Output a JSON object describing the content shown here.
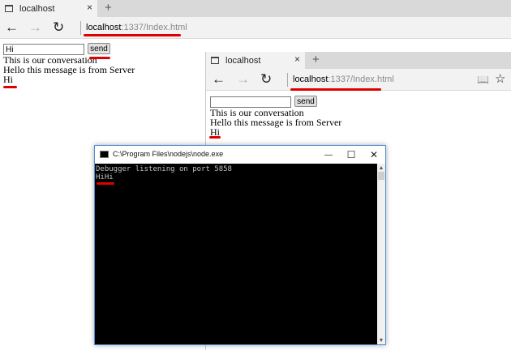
{
  "browser1": {
    "tab_title": "localhost",
    "tab_close": "×",
    "new_tab": "+",
    "back": "←",
    "forward": "→",
    "refresh": "↻",
    "address_host": "localhost",
    "address_path": ":1337/Index.html",
    "input_value": "Hi",
    "send_label": "send",
    "lines": [
      "This is our conversation",
      "Hello this message is from Server",
      "Hi"
    ]
  },
  "browser2": {
    "tab_title": "localhost",
    "tab_close": "×",
    "new_tab": "+",
    "back": "←",
    "forward": "→",
    "refresh": "↻",
    "address_host": "localhost",
    "address_path": ":1337/Index.html",
    "reading_view": "📖",
    "favorite": "☆",
    "input_value": "",
    "send_label": "send",
    "lines": [
      "This is our conversation",
      "Hello this message is from Server",
      "Hi"
    ]
  },
  "console": {
    "title": "C:\\Program Files\\nodejs\\node.exe",
    "minimize": "—",
    "maximize": "☐",
    "close": "✕",
    "lines": [
      "Debugger listening on port 5858",
      "HiHi"
    ],
    "scroll_up": "▲",
    "scroll_down": "▼"
  },
  "colors": {
    "annotation_red": "#e00000",
    "console_border": "#4a90d9"
  }
}
